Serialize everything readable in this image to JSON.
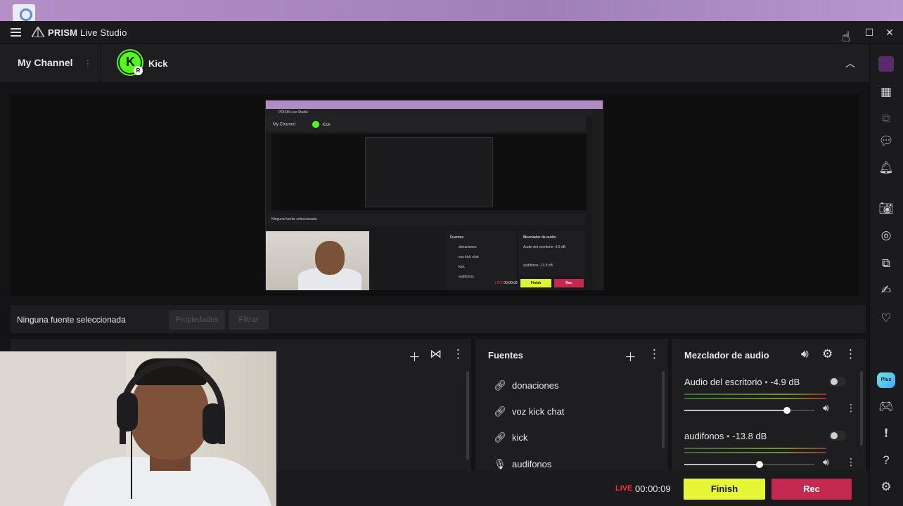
{
  "app": {
    "brand_bold": "PRISM",
    "brand_rest": " Live Studio"
  },
  "channel": {
    "title": "My Channel",
    "platform": "Kick",
    "platform_initial": "K",
    "badge": "R"
  },
  "selection": {
    "label": "Ninguna fuente seleccionada",
    "properties_label": "Propiedades",
    "filters_label": "Filtrar"
  },
  "sources": {
    "title": "Fuentes",
    "items": [
      {
        "label": "donaciones",
        "icon": "link-icon"
      },
      {
        "label": "voz kick chat",
        "icon": "link-icon"
      },
      {
        "label": "kick",
        "icon": "link-icon"
      },
      {
        "label": "audifonos",
        "icon": "microphone-icon"
      }
    ]
  },
  "mixer": {
    "title": "Mezclador de audio",
    "channels": [
      {
        "name": "Audio del escritorio",
        "level": "-4.9 dB",
        "volume": 0.79
      },
      {
        "name": "audifonos",
        "level": "-13.8 dB",
        "volume": 0.58
      }
    ]
  },
  "status": {
    "live": "LIVE",
    "timer": "00:00:09",
    "finish_label": "Finish",
    "rec_label": "Rec"
  },
  "nested_preview": {
    "brand": "PRISM Live Studio",
    "channel": "My Channel",
    "platform": "Kick",
    "selection": "Ninguna fuente seleccionada",
    "sources_title": "Fuentes",
    "sources": [
      "donaciones",
      "voz kick chat",
      "kick",
      "audifonos"
    ],
    "mixer_title": "Mezclador de audio",
    "mixer_rows": [
      "Audio del escritorio -4.9 dB",
      "audifonos -13.8 dB"
    ],
    "live": "LIVE",
    "timer": "00:00:09",
    "finish": "Finish",
    "rec": "Rec"
  },
  "colors": {
    "accent_finish": "#e6f636",
    "accent_rec": "#c42a4f",
    "live_red": "#ff2b3a",
    "kick_green": "#53fc18"
  }
}
